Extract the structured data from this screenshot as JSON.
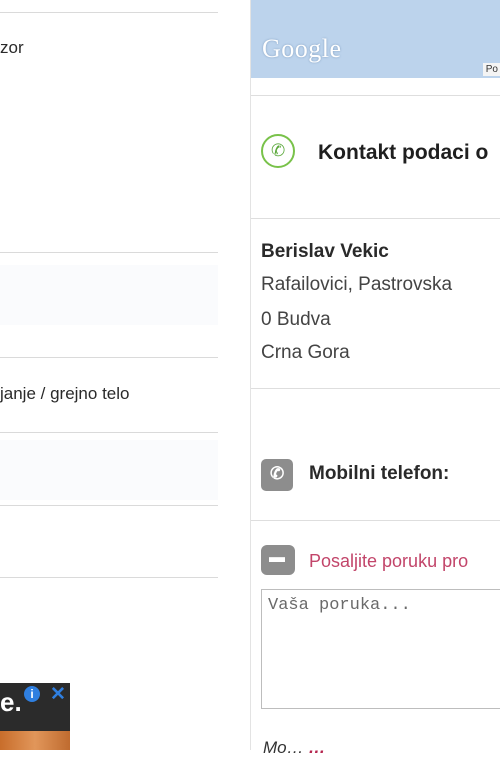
{
  "left_panel": {
    "rows": [
      {
        "label": "zor"
      },
      {
        "label": ""
      },
      {
        "label": "janje / grejno telo"
      }
    ]
  },
  "ad": {
    "text": "e.",
    "info_glyph": "i",
    "close_glyph": "✕"
  },
  "map": {
    "logo": "Google",
    "corner_label": "Po"
  },
  "contact": {
    "title": "Kontakt podaci o",
    "name": "Berislav Vekic",
    "address_line1": "Rafailovici, Pastrovska",
    "address_line2": "0 Budva",
    "country": "Crna Gora",
    "mobile_label": "Mobilni telefon:",
    "message_link": "Posaljite poruku pro",
    "message_placeholder": "Vaša poruka...",
    "bottom_note_prefix": "Mo…",
    "bottom_note_emph": "…"
  },
  "icons": {
    "phone": "phone-icon",
    "mobile": "mobile-phone-icon",
    "message": "speech-bubble-icon",
    "ad_info": "info-icon",
    "ad_close": "close-icon"
  },
  "colors": {
    "accent_green": "#79c24a",
    "link_pink": "#c2456a",
    "icon_gray": "#8d8d8d",
    "map_blue": "#bcd3ec"
  }
}
